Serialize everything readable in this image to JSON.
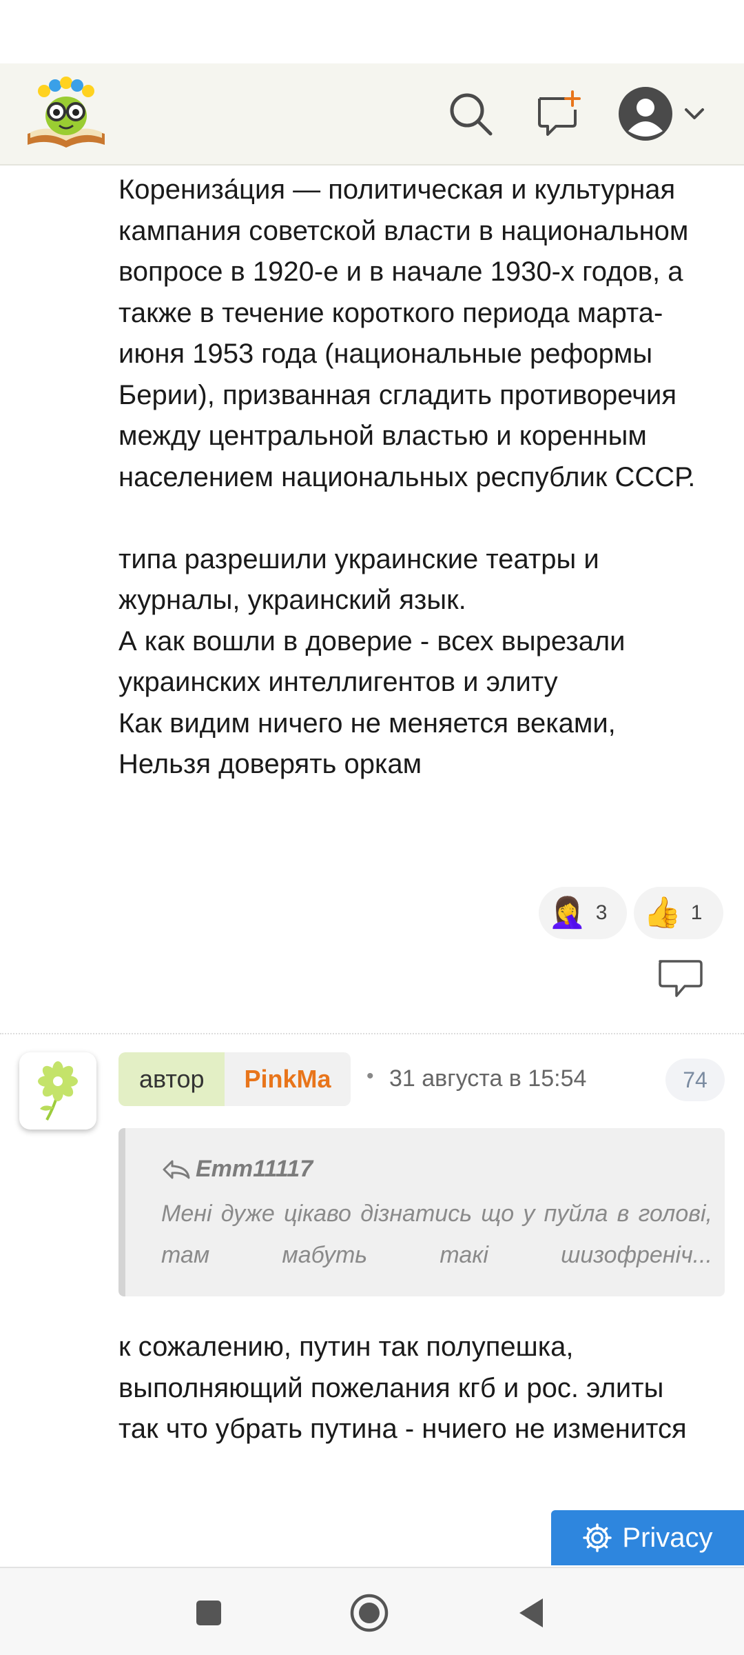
{
  "comment1": {
    "text": "Корениза́ция — политическая и культурная кампания советской власти в национальном вопросе в 1920-е и в начале 1930-х годов, а также в течение короткого периода марта-июня 1953 года (национальные реформы Берии), призванная сгладить противоречия между центральной властью и коренным населением национальных республик СССР.\n\nтипа разрешили украинские театры и журналы, украинский язык.\nА как вошли в доверие - всех вырезали украинских интеллигентов и элиту\nКак видим ничего не меняется веками,\nНельзя доверять оркам",
    "reactions": [
      {
        "emoji": "🤦‍♀️",
        "count": "3"
      },
      {
        "emoji": "👍",
        "count": "1"
      }
    ]
  },
  "comment2": {
    "author_role": "автор",
    "author_name": "PinkMa",
    "separator": "•",
    "date": "31 августа в 15:54",
    "number": "74",
    "quote": {
      "author": "Emm11117",
      "text": "Мені дуже цікаво дізнатись що у пуйла в голові, там мабуть такі шизофреніч..."
    },
    "text": "к сожалению, путин так полупешка, выполняющий пожелания кгб и рос. элиты\nтак что убрать путина - нчиего не изменится"
  },
  "privacy_label": "Privacy",
  "colors": {
    "accent_orange": "#e8751b",
    "privacy_blue": "#2e86de",
    "author_badge_green": "#e3efc5",
    "header_bg": "#f5f5ef"
  }
}
